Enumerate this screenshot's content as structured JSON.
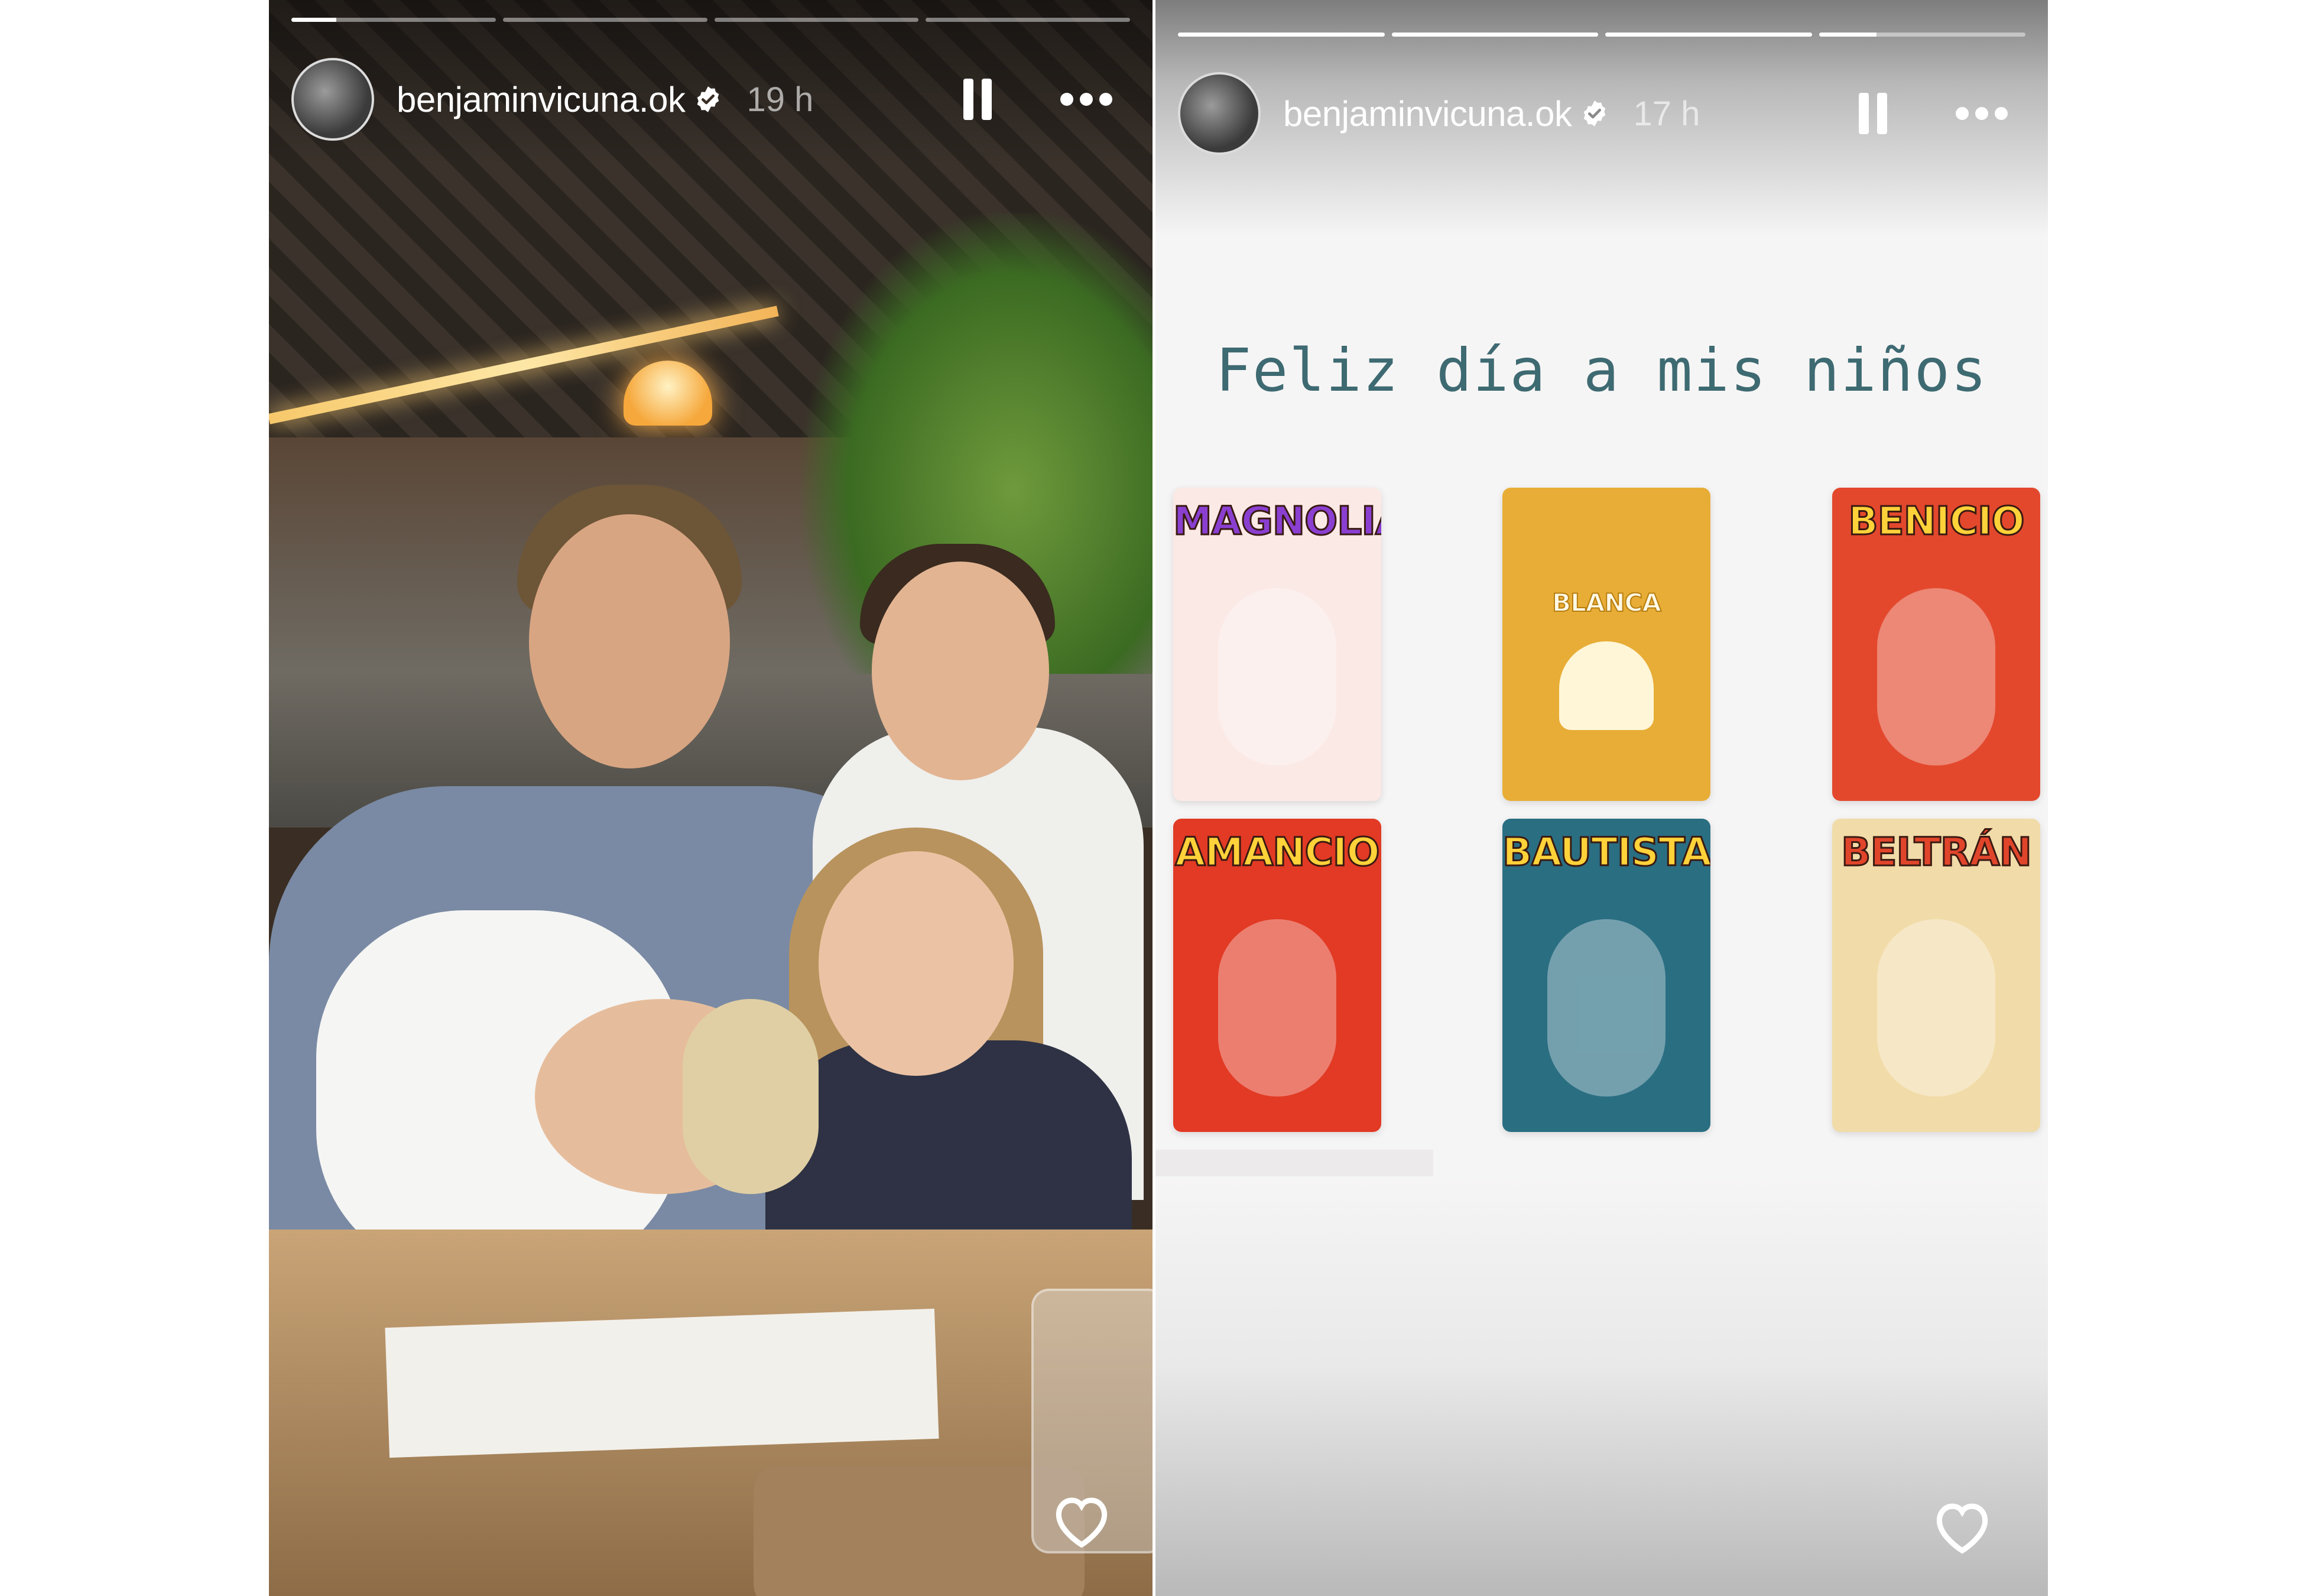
{
  "stories": [
    {
      "username": "benjaminvicuna.ok",
      "time": "19 h",
      "progress": [
        0.22,
        0,
        0,
        0
      ],
      "image_description": "photo"
    },
    {
      "username": "benjaminvicuna.ok",
      "time": "17 h",
      "progress": [
        1,
        1,
        1,
        0.28
      ],
      "caption": "Feliz día a mis niños",
      "cards": [
        {
          "name": "MAGNOLIA",
          "bg": "#fbe9e6",
          "text_color": "#8a3fd1"
        },
        {
          "name": "BLANCA",
          "bg": "#e8ad36",
          "text_color": "#fff9e6"
        },
        {
          "name": "BENICIO",
          "bg": "#e3482d",
          "text_color": "#ffd23a"
        },
        {
          "name": "AMANCIO",
          "bg": "#e23a24",
          "text_color": "#ffd23a"
        },
        {
          "name": "BAUTISTA",
          "bg": "#2a6e82",
          "text_color": "#ffd23a"
        },
        {
          "name": "BELTRÁN",
          "bg": "#f1dba8",
          "text_color": "#e0452b"
        }
      ]
    }
  ],
  "icons": {
    "verified": "verified-badge-icon",
    "pause": "pause-icon",
    "more": "more-options-icon",
    "like": "heart-icon"
  },
  "colors": {
    "caption": "#3e6a72",
    "verified_badge": "#ffffff"
  }
}
